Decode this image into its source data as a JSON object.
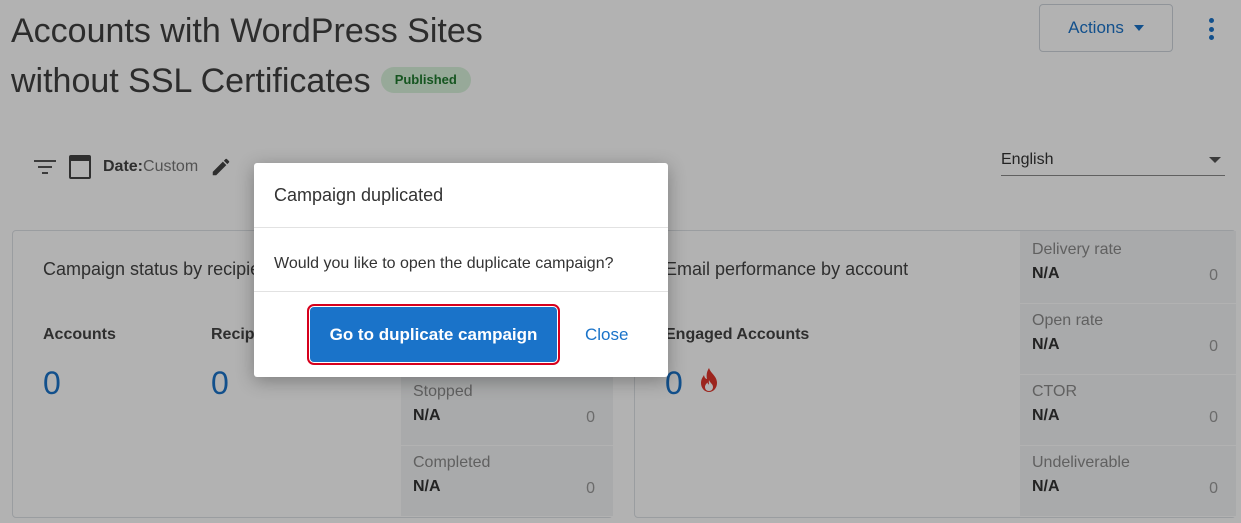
{
  "header": {
    "title_line1": "Accounts with WordPress Sites",
    "title_line2": "without SSL Certificates",
    "status_badge": "Published",
    "actions_label": "Actions"
  },
  "filters": {
    "date_key": "Date:",
    "date_value": "Custom",
    "language": "English"
  },
  "campaign_card": {
    "title": "Campaign status by recipient",
    "accounts_label": "Accounts",
    "accounts_value": "0",
    "recipients_label": "Recipients",
    "recipients_value": "0",
    "metrics": [
      {
        "label": "Stopped",
        "value": "N/A",
        "count": "0"
      },
      {
        "label": "Completed",
        "value": "N/A",
        "count": "0"
      }
    ]
  },
  "email_card": {
    "title": "Email performance by account",
    "engaged_label": "Engaged Accounts",
    "engaged_value": "0",
    "metrics": [
      {
        "label": "Delivery rate",
        "value": "N/A",
        "count": "0"
      },
      {
        "label": "Open rate",
        "value": "N/A",
        "count": "0"
      },
      {
        "label": "CTOR",
        "value": "N/A",
        "count": "0"
      },
      {
        "label": "Undeliverable",
        "value": "N/A",
        "count": "0"
      }
    ]
  },
  "dialog": {
    "title": "Campaign duplicated",
    "message": "Would you like to open the duplicate campaign?",
    "primary_button": "Go to duplicate campaign",
    "close_button": "Close"
  },
  "colors": {
    "accent": "#1a73c9",
    "badge_bg": "#d9f2dc",
    "badge_text": "#1f7a2e",
    "highlight_outline": "#d6001c",
    "flame": "#e0362c"
  },
  "icons": [
    "filter-icon",
    "calendar-icon",
    "pencil-icon",
    "kebab-menu-icon",
    "caret-down-icon",
    "flame-icon"
  ]
}
